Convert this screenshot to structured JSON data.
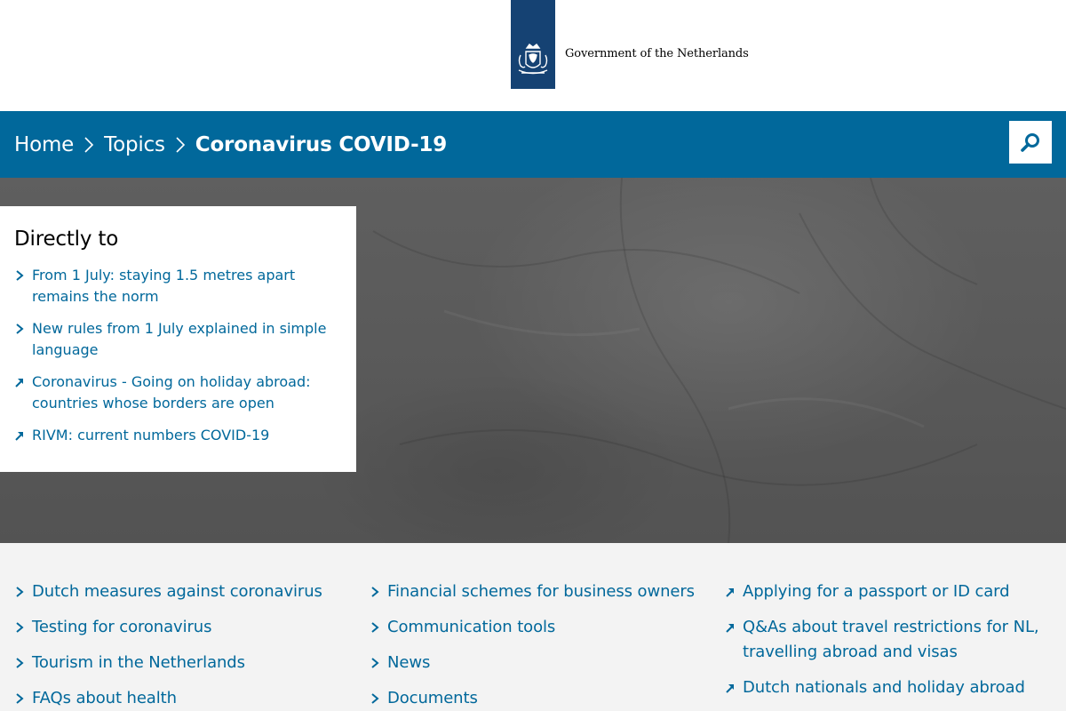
{
  "header": {
    "logo_text": "Government of the Netherlands",
    "ribbon_color": "#154273"
  },
  "breadcrumb": {
    "items": [
      {
        "label": "Home"
      },
      {
        "label": "Topics"
      },
      {
        "label": "Coronavirus COVID-19"
      }
    ],
    "bar_color": "#01689b",
    "search_icon": "search-icon"
  },
  "directly_to": {
    "heading": "Directly to",
    "links": [
      {
        "label": "From 1 July: staying 1.5 metres apart remains the norm",
        "icon": "chevron-right-icon"
      },
      {
        "label": "New rules from 1 July explained in simple language",
        "icon": "chevron-right-icon"
      },
      {
        "label": "Coronavirus - Going on holiday abroad: countries whose borders are open",
        "icon": "external-link-icon"
      },
      {
        "label": "RIVM: current numbers COVID-19",
        "icon": "external-link-icon"
      }
    ]
  },
  "links": {
    "col1": [
      {
        "label": "Dutch measures against coronavirus",
        "icon": "chevron-right-icon"
      },
      {
        "label": "Testing for coronavirus",
        "icon": "chevron-right-icon"
      },
      {
        "label": "Tourism in the Netherlands",
        "icon": "chevron-right-icon"
      },
      {
        "label": "FAQs about health",
        "icon": "chevron-right-icon"
      }
    ],
    "col2": [
      {
        "label": "Financial schemes for business owners",
        "icon": "chevron-right-icon"
      },
      {
        "label": "Communication tools",
        "icon": "chevron-right-icon"
      },
      {
        "label": "News",
        "icon": "chevron-right-icon"
      },
      {
        "label": "Documents",
        "icon": "chevron-right-icon"
      }
    ],
    "col3": [
      {
        "label": "Applying for a passport or ID card",
        "icon": "external-link-icon"
      },
      {
        "label": "Q&As about travel restrictions for NL, travelling abroad and visas",
        "icon": "external-link-icon"
      },
      {
        "label": "Dutch nationals and holiday abroad",
        "icon": "external-link-icon"
      }
    ]
  },
  "colors": {
    "link": "#01689b",
    "lower_bg": "#f3f3f3"
  }
}
